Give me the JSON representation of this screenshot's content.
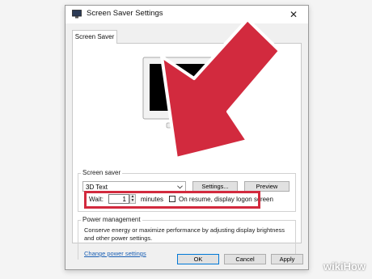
{
  "window": {
    "title": "Screen Saver Settings",
    "close_glyph": "✕",
    "tab_label": "Screen Saver"
  },
  "screen_saver": {
    "group_label": "Screen saver",
    "selected_saver": "3D Text",
    "settings_label": "Settings...",
    "preview_label": "Preview",
    "wait_label": "Wait:",
    "wait_value": "1",
    "minutes_label": "minutes",
    "resume_label": "On resume, display logon screen",
    "resume_checked": false
  },
  "power": {
    "group_label": "Power management",
    "description": "Conserve energy or maximize performance by adjusting display brightness and other power settings.",
    "link_label": "Change power settings"
  },
  "footer": {
    "ok_label": "OK",
    "cancel_label": "Cancel",
    "apply_label": "Apply"
  },
  "watermark": "wikiHow",
  "colors": {
    "arrow": "#d22a3e",
    "link": "#1a5fb4",
    "accent": "#0078d7"
  },
  "icons": [
    "screen-saver-app-icon",
    "close-icon",
    "monitor-preview-icon",
    "spin-up-icon",
    "spin-down-icon",
    "dropdown-chevron-icon",
    "annotation-arrow-icon"
  ]
}
